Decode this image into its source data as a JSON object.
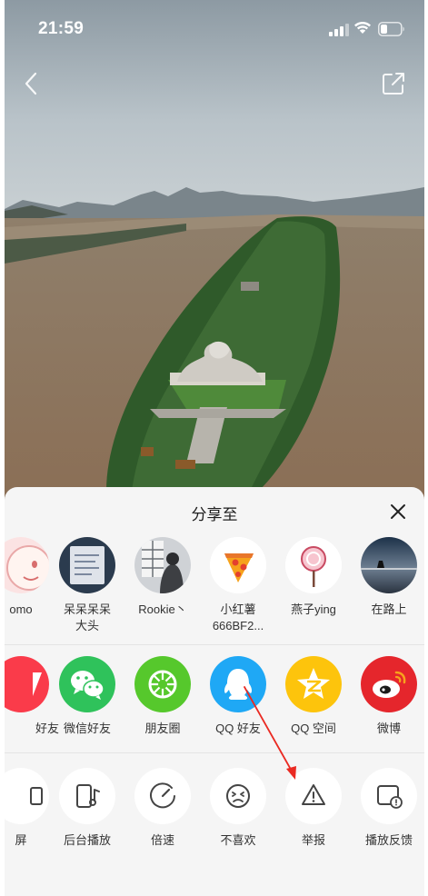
{
  "status_bar": {
    "time": "21:59"
  },
  "share_sheet": {
    "title": "分享至",
    "contacts": [
      {
        "label": "omo"
      },
      {
        "label": "呆呆呆呆大头"
      },
      {
        "label": "Rookie丶"
      },
      {
        "label": "小红薯666BF2..."
      },
      {
        "label": "燕子ying"
      },
      {
        "label": "在路上"
      }
    ],
    "apps": [
      {
        "label": "好友",
        "icon": "partial-red-app-icon",
        "color": "#fa3b4a"
      },
      {
        "label": "微信好友",
        "icon": "wechat-icon",
        "color": "#2fc25b"
      },
      {
        "label": "朋友圈",
        "icon": "moments-icon",
        "color": "#56c82c"
      },
      {
        "label": "QQ 好友",
        "icon": "qq-icon",
        "color": "#1fa8f5"
      },
      {
        "label": "QQ 空间",
        "icon": "qzone-icon",
        "color": "#fdc40c"
      },
      {
        "label": "微博",
        "icon": "weibo-icon",
        "color": "#e5262c"
      }
    ],
    "actions": [
      {
        "label": "屏",
        "icon": "partial-screen-icon"
      },
      {
        "label": "后台播放",
        "icon": "background-play-icon"
      },
      {
        "label": "倍速",
        "icon": "speed-icon"
      },
      {
        "label": "不喜欢",
        "icon": "dislike-icon"
      },
      {
        "label": "举报",
        "icon": "report-icon"
      },
      {
        "label": "播放反馈",
        "icon": "playback-feedback-icon"
      }
    ]
  }
}
